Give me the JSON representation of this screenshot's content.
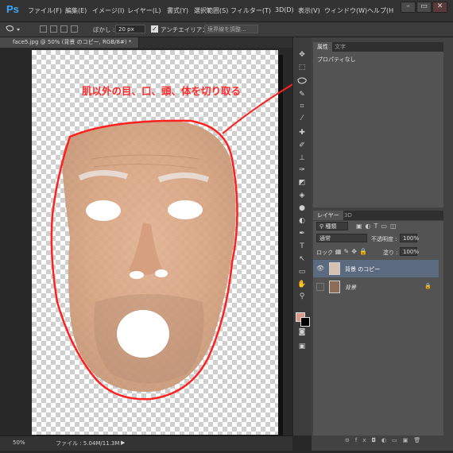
{
  "app": {
    "logo": "Ps"
  },
  "menu": [
    "ファイル(F)",
    "編集(E)",
    "イメージ(I)",
    "レイヤー(L)",
    "書式(Y)",
    "選択範囲(S)",
    "フィルター(T)",
    "3D(D)",
    "表示(V)",
    "ウィンドウ(W)",
    "ヘルプ(H"
  ],
  "window_buttons": [
    "–",
    "▭",
    "✕"
  ],
  "options": {
    "feather_label": "ぼかし :",
    "feather_value": "20 px",
    "antialias_label": "アンチエイリアス",
    "antialias_checked": true,
    "refine_button": "境界線を調整..."
  },
  "document": {
    "tab_title": "face5.jpg @ 50% (背景 のコピー, RGB/8#) *",
    "annotation": "肌以外の目、口、頭、体を切り取る",
    "zoom": "50%",
    "file_info": "ファイル : 5.04M/11.3M"
  },
  "properties_panel": {
    "tabs": [
      "属性",
      "文字"
    ],
    "content": "プロパティなし"
  },
  "layers_panel": {
    "tabs": [
      "レイヤー",
      "3D"
    ],
    "filter_kind": "種類",
    "blend_mode": "通常",
    "opacity_label": "不透明度 :",
    "opacity_value": "100%",
    "lock_label": "ロック :",
    "fill_label": "塗り :",
    "fill_value": "100%",
    "layers": [
      {
        "name": "背景 のコピー",
        "selected": true,
        "visible": true
      },
      {
        "name": "背景",
        "selected": false,
        "visible": false,
        "locked": true
      }
    ]
  },
  "colors": {
    "annotation_red": "#ff2020",
    "foreground_swatch": "#d9998b",
    "selection_highlight": "#5b6a7e"
  }
}
